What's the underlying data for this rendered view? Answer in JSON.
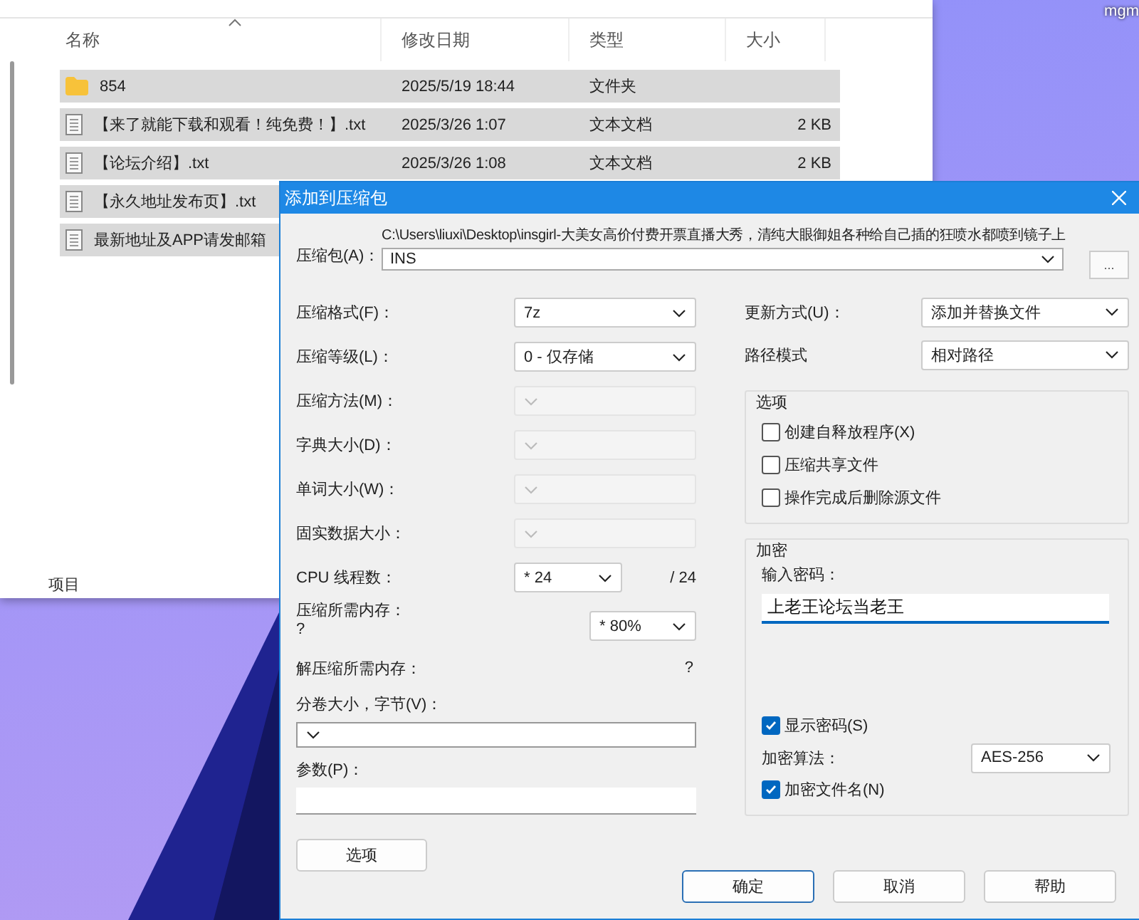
{
  "desktop": {
    "label": "mgm"
  },
  "explorer": {
    "columns": [
      "名称",
      "修改日期",
      "类型",
      "大小"
    ],
    "rows": [
      {
        "kind": "folder",
        "name": "854",
        "date": "2025/5/19 18:44",
        "type": "文件夹",
        "selected": true
      },
      {
        "kind": "text",
        "name": "【来了就能下载和观看！纯免费！】.txt",
        "date": "2025/3/26 1:07",
        "type": "文本文档",
        "size": "2 KB",
        "selected": true
      },
      {
        "kind": "text",
        "name": "【论坛介绍】.txt",
        "date": "2025/3/26 1:08",
        "type": "文本文档",
        "size": "2 KB",
        "selected": true
      },
      {
        "kind": "text",
        "name": "【永久地址发布页】.txt",
        "selected": true
      },
      {
        "kind": "text",
        "name": "最新地址及APP请发邮箱",
        "selected": true
      }
    ],
    "status_bar": "项目"
  },
  "dialog": {
    "title": "添加到压缩包",
    "archive": {
      "label": "压缩包(A)：",
      "path": "C:\\Users\\liuxi\\Desktop\\insgirl-大美女高价付费开票直播大秀，清纯大眼御姐各种给自己插的狂喷水都喷到镜子上",
      "value": "INS",
      "browse": "..."
    },
    "left_fields": [
      {
        "kind": "select",
        "label": "压缩格式(F)：",
        "value": "7z",
        "disabled": false
      },
      {
        "kind": "select",
        "label": "压缩等级(L)：",
        "value": "0 - 仅存储",
        "disabled": false
      },
      {
        "kind": "select",
        "label": "压缩方法(M)：",
        "disabled": true
      },
      {
        "kind": "select",
        "label": "字典大小(D)：",
        "disabled": true
      },
      {
        "kind": "select",
        "label": "单词大小(W)：",
        "disabled": true
      },
      {
        "kind": "select",
        "label": "固实数据大小：",
        "disabled": true
      },
      {
        "kind": "threads",
        "label": "CPU 线程数：",
        "value": "* 24",
        "suffix": "/ 24",
        "disabled": false
      },
      {
        "kind": "memory",
        "label": "压缩所需内存：",
        "note": "?",
        "value": "* 80%",
        "disabled": false
      },
      {
        "kind": "info",
        "label": "解压缩所需内存：",
        "value": "?"
      },
      {
        "kind": "wide_select",
        "label": "分卷大小，字节(V)："
      },
      {
        "kind": "wide_input",
        "label": "参数(P)："
      }
    ],
    "right_fields": [
      {
        "label": "更新方式(U)：",
        "value": "添加并替换文件"
      },
      {
        "label": "路径模式",
        "value": "相对路径"
      }
    ],
    "options": {
      "title": "选项",
      "items": [
        {
          "label": "创建自释放程序(X)",
          "checked": false
        },
        {
          "label": "压缩共享文件",
          "checked": false
        },
        {
          "label": "操作完成后删除源文件",
          "checked": false
        }
      ]
    },
    "encryption": {
      "title": "加密",
      "password_label": "输入密码：",
      "password": "上老王论坛当老王",
      "show_password": {
        "label": "显示密码(S)",
        "checked": true
      },
      "method": {
        "label": "加密算法：",
        "value": "AES-256"
      },
      "encrypt_names": {
        "label": "加密文件名(N)",
        "checked": true
      }
    },
    "options_button": "选项",
    "buttons": [
      {
        "label": "确定",
        "default": true
      },
      {
        "label": "取消",
        "default": false
      },
      {
        "label": "帮助",
        "default": false
      }
    ]
  }
}
